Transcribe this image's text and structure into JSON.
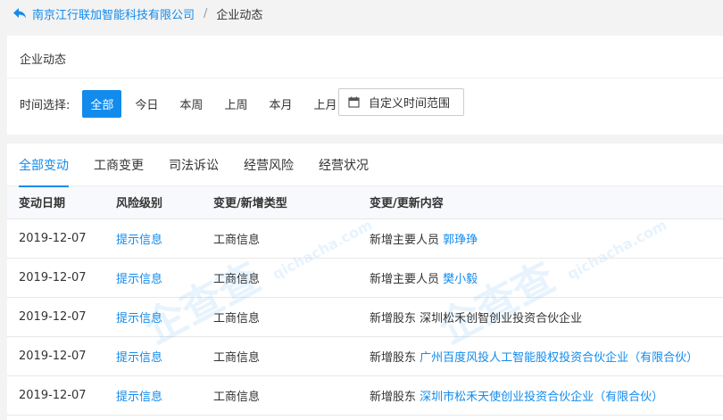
{
  "breadcrumb": {
    "company": "南京江行联加智能科技有限公司",
    "separator": "/",
    "current": "企业动态"
  },
  "filter_card": {
    "title": "企业动态",
    "time_label": "时间选择:",
    "options": [
      "全部",
      "今日",
      "本周",
      "上周",
      "本月",
      "上月"
    ],
    "active_option": "全部",
    "custom_range": "自定义时间范围"
  },
  "tabs": [
    {
      "label": "全部变动",
      "active": true
    },
    {
      "label": "工商变更",
      "active": false
    },
    {
      "label": "司法诉讼",
      "active": false
    },
    {
      "label": "经营风险",
      "active": false
    },
    {
      "label": "经营状况",
      "active": false
    }
  ],
  "table": {
    "headers": [
      "变动日期",
      "风险级别",
      "变更/新增类型",
      "变更/更新内容"
    ],
    "rows": [
      {
        "date": "2019-12-07",
        "risk": "提示信息",
        "type": "工商信息",
        "prefix": "新增主要人员",
        "entity": "郭琤琤"
      },
      {
        "date": "2019-12-07",
        "risk": "提示信息",
        "type": "工商信息",
        "prefix": "新增主要人员",
        "entity": "樊小毅"
      },
      {
        "date": "2019-12-07",
        "risk": "提示信息",
        "type": "工商信息",
        "prefix": "新增股东",
        "entity": "深圳松禾创智创业投资合伙企业"
      },
      {
        "date": "2019-12-07",
        "risk": "提示信息",
        "type": "工商信息",
        "prefix": "新增股东",
        "entity": "广州百度风投人工智能股权投资合伙企业（有限合伙）"
      },
      {
        "date": "2019-12-07",
        "risk": "提示信息",
        "type": "工商信息",
        "prefix": "新增股东",
        "entity": "深圳市松禾天使创业投资合伙企业（有限合伙）"
      }
    ]
  },
  "watermark": {
    "text": "企查查",
    "url": "qichacha.com"
  },
  "colors": {
    "accent": "#128bed",
    "background": "#f3f3f3"
  }
}
